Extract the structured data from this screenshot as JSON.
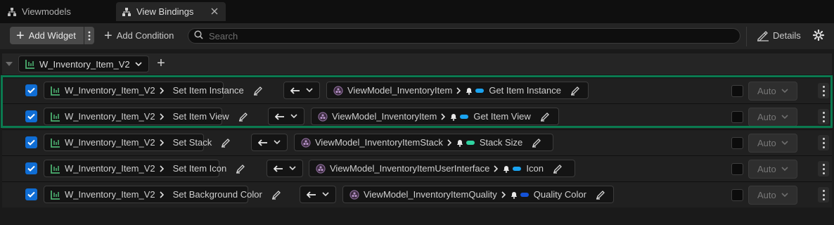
{
  "tabs": [
    {
      "label": "Viewmodels",
      "icon": "hierarchy-icon",
      "active": false
    },
    {
      "label": "View Bindings",
      "icon": "hierarchy-icon",
      "active": true
    }
  ],
  "toolbar": {
    "add_widget_label": "Add Widget",
    "add_condition_label": "Add Condition",
    "search_placeholder": "Search",
    "details_label": "Details"
  },
  "widget_selector": {
    "label": "W_Inventory_Item_V2"
  },
  "colors": {
    "accent_blue": "#0f6dd4",
    "highlight_green": "#0b7a50",
    "pin_cyan": "#1aa3f0",
    "pin_teal": "#2fd3a0",
    "pin_darkblue": "#1452d8"
  },
  "bindings": [
    {
      "widget": "W_Inventory_Item_V2",
      "widget_prop": "Set Item Instance",
      "widget_pin": "cyan",
      "direction": "←",
      "viewmodel": "ViewModel_InventoryItem",
      "vm_prop": "Get Item Instance",
      "vm_pin": "cyan",
      "auto": "Auto",
      "checked": true
    },
    {
      "widget": "W_Inventory_Item_V2",
      "widget_prop": "Set Item View",
      "widget_pin": "cyan",
      "direction": "←",
      "viewmodel": "ViewModel_InventoryItem",
      "vm_prop": "Get Item View",
      "vm_pin": "cyan",
      "auto": "Auto",
      "checked": true
    },
    {
      "widget": "W_Inventory_Item_V2",
      "widget_prop": "Set Stack",
      "widget_pin": "teal",
      "direction": "←",
      "viewmodel": "ViewModel_InventoryItemStack",
      "vm_prop": "Stack Size",
      "vm_pin": "teal",
      "auto": "Auto",
      "checked": true
    },
    {
      "widget": "W_Inventory_Item_V2",
      "widget_prop": "Set Item Icon",
      "widget_pin": "cyan",
      "direction": "←",
      "viewmodel": "ViewModel_InventoryItemUserInterface",
      "vm_prop": "Icon",
      "vm_pin": "cyan",
      "auto": "Auto",
      "checked": true
    },
    {
      "widget": "W_Inventory_Item_V2",
      "widget_prop": "Set Background Color",
      "widget_pin": "darkblue",
      "direction": "←",
      "viewmodel": "ViewModel_InventoryItemQuality",
      "vm_prop": "Quality Color",
      "vm_pin": "darkblue",
      "auto": "Auto",
      "checked": true
    }
  ]
}
